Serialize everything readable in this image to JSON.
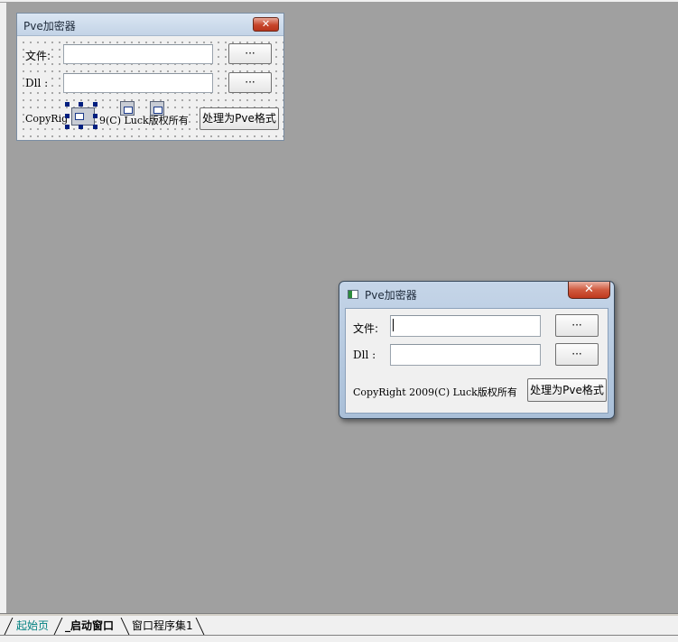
{
  "design_form": {
    "title": "Pve加密器",
    "close_glyph": "✕",
    "file_label": "文件:",
    "dll_label": "Dll :",
    "browse_file_label": "···",
    "browse_dll_label": "···",
    "copyright_left": "CopyRig",
    "copyright_right": "9(C) Luck版权所有",
    "process_button_label": "处理为Pve格式"
  },
  "preview_window": {
    "title": "Pve加密器",
    "close_glyph": "✕",
    "file_label": "文件:",
    "dll_label": "Dll :",
    "browse_file_label": "···",
    "browse_dll_label": "···",
    "copyright": "CopyRight 2009(C) Luck版权所有",
    "process_button_label": "处理为Pve格式"
  },
  "tabs": [
    {
      "label": "起始页"
    },
    {
      "label": "_启动窗口"
    },
    {
      "label": "窗口程序集1"
    }
  ]
}
